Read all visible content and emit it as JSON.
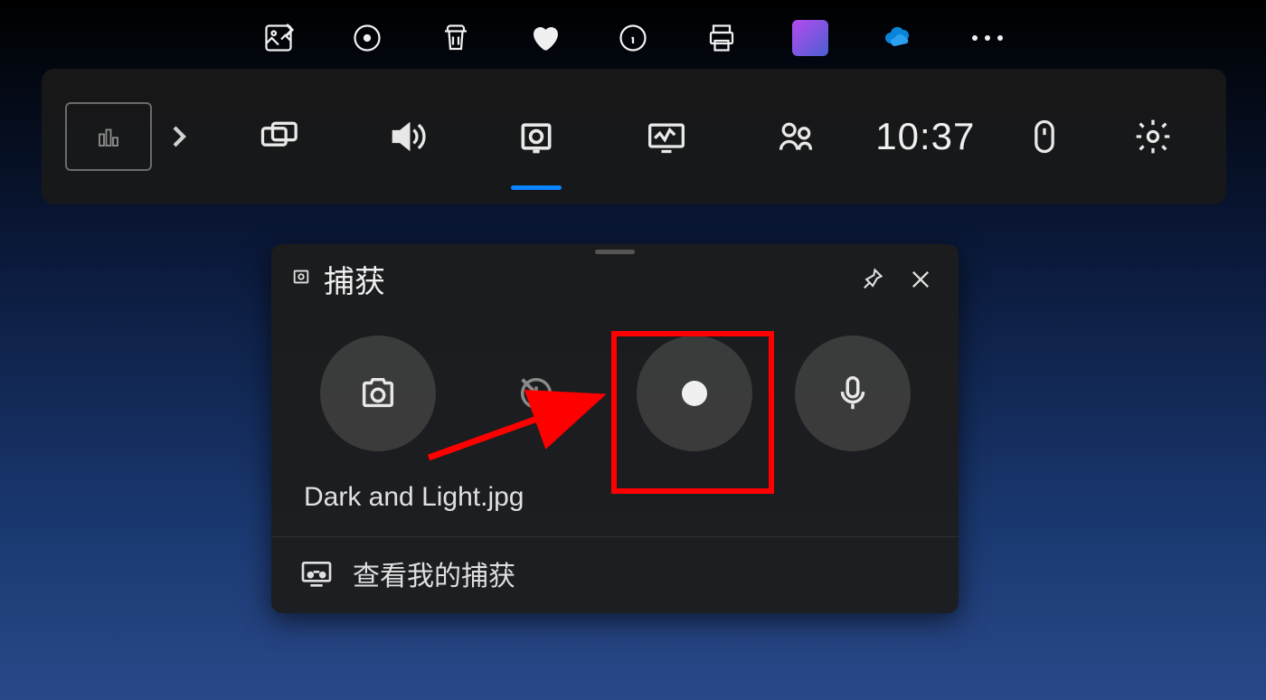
{
  "gamebar": {
    "time": "10:37"
  },
  "capture_widget": {
    "title": "捕获",
    "filename": "Dark and Light.jpg",
    "view_captures_label": "查看我的捕获"
  }
}
